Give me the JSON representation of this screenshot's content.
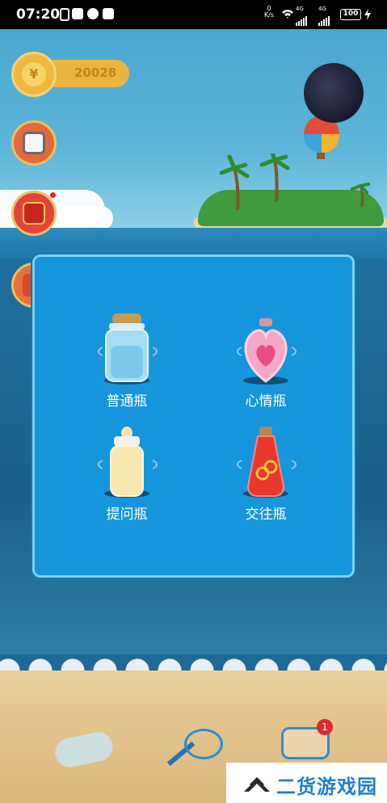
{
  "status_bar": {
    "time": "07:20",
    "net_speed_value": "0",
    "net_speed_unit": "K/s",
    "sim1": "4G",
    "sim2": "4G",
    "battery": "100"
  },
  "header": {
    "coins": "20028"
  },
  "modal": {
    "options": [
      {
        "label": "普通瓶",
        "icon": "plain-bottle-icon"
      },
      {
        "label": "心情瓶",
        "icon": "heart-bottle-icon"
      },
      {
        "label": "提问瓶",
        "icon": "question-bottle-icon"
      },
      {
        "label": "交往瓶",
        "icon": "dating-bottle-icon"
      }
    ]
  },
  "bottom": {
    "badge_count": "1"
  },
  "watermark": {
    "text": "二货游戏园"
  },
  "colors": {
    "modal_bg": "#1596dc",
    "modal_border": "#7fd2f5",
    "coin": "#e9b53d",
    "badge": "#d92b2b"
  }
}
